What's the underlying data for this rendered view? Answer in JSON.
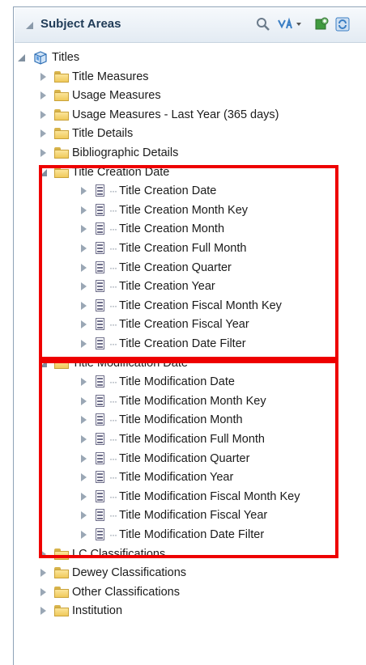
{
  "panel": {
    "title": "Subject Areas",
    "toolbar": [
      "search-icon",
      "sort-icon",
      "add-subject-area-icon",
      "refresh-icon"
    ]
  },
  "tree": {
    "root": "Titles",
    "folders_top": [
      "Title Measures",
      "Usage Measures",
      "Usage Measures - Last Year (365 days)",
      "Title Details",
      "Bibliographic Details"
    ],
    "creation": {
      "label": "Title Creation Date",
      "columns": [
        "Title Creation Date",
        "Title Creation Month Key",
        "Title Creation Month",
        "Title Creation Full Month",
        "Title Creation Quarter",
        "Title Creation Year",
        "Title Creation Fiscal Month Key",
        "Title Creation Fiscal Year",
        "Title Creation Date Filter"
      ]
    },
    "modification": {
      "label": "Title Modification Date",
      "columns": [
        "Title Modification Date",
        "Title Modification Month Key",
        "Title Modification Month",
        "Title Modification Full Month",
        "Title Modification Quarter",
        "Title Modification Year",
        "Title Modification Fiscal Month Key",
        "Title Modification Fiscal Year",
        "Title Modification Date Filter"
      ]
    },
    "folders_bottom": [
      "LC Classifications",
      "Dewey Classifications",
      "Other Classifications",
      "Institution"
    ]
  },
  "colors": {
    "highlight": "#ee0000",
    "folder": "#f0c95a",
    "header_text": "#1f3b57"
  }
}
